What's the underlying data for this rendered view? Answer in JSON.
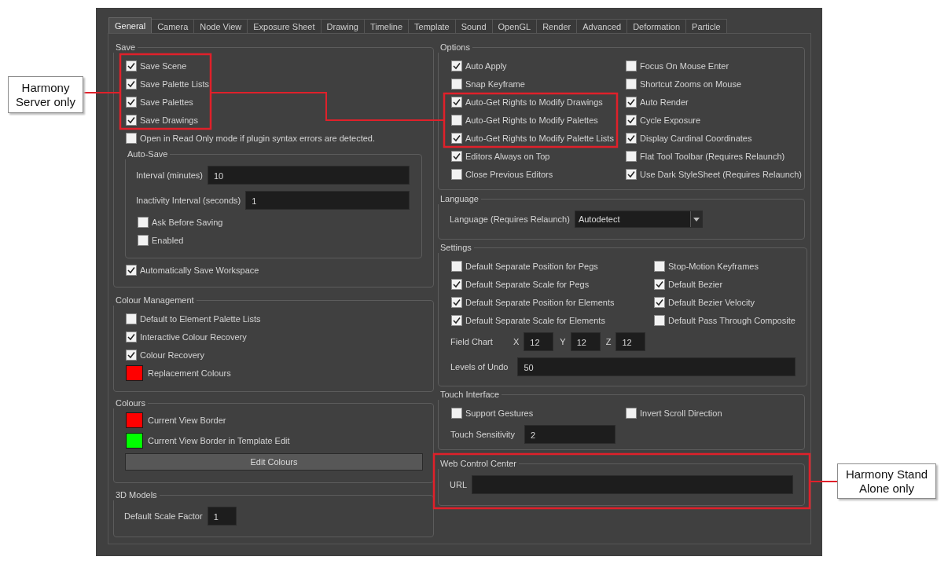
{
  "tabs": [
    {
      "label": "General",
      "selected": true
    },
    {
      "label": "Camera",
      "selected": false
    },
    {
      "label": "Node View",
      "selected": false
    },
    {
      "label": "Exposure Sheet",
      "selected": false
    },
    {
      "label": "Drawing",
      "selected": false
    },
    {
      "label": "Timeline",
      "selected": false
    },
    {
      "label": "Template",
      "selected": false
    },
    {
      "label": "Sound",
      "selected": false
    },
    {
      "label": "OpenGL",
      "selected": false
    },
    {
      "label": "Render",
      "selected": false
    },
    {
      "label": "Advanced",
      "selected": false
    },
    {
      "label": "Deformation",
      "selected": false
    },
    {
      "label": "Particle",
      "selected": false
    }
  ],
  "save": {
    "title": "Save",
    "checks": [
      {
        "label": "Save Scene",
        "checked": true
      },
      {
        "label": "Save Palette Lists",
        "checked": true
      },
      {
        "label": "Save Palettes",
        "checked": true
      },
      {
        "label": "Save Drawings",
        "checked": true
      },
      {
        "label": "Open in Read Only mode if plugin syntax errors are detected.",
        "checked": false
      }
    ],
    "auto_save": {
      "title": "Auto-Save",
      "fields": [
        {
          "label": "Interval (minutes)",
          "value": "10"
        },
        {
          "label": "Inactivity Interval (seconds)",
          "value": "1"
        }
      ],
      "checks": [
        {
          "label": "Ask Before Saving",
          "checked": false
        },
        {
          "label": "Enabled",
          "checked": false
        }
      ]
    },
    "workspace": {
      "label": "Automatically Save Workspace",
      "checked": true
    }
  },
  "colour_management": {
    "title": "Colour Management",
    "checks": [
      {
        "label": "Default to Element Palette Lists",
        "checked": false
      },
      {
        "label": "Interactive Colour Recovery",
        "checked": true
      },
      {
        "label": "Colour Recovery",
        "checked": true
      }
    ],
    "swatch": {
      "label": "Replacement Colours",
      "color": "#ff0000"
    }
  },
  "colours": {
    "title": "Colours",
    "swatches": [
      {
        "label": "Current View Border",
        "color": "#ff0000"
      },
      {
        "label": "Current View Border in Template Edit",
        "color": "#00ff00"
      }
    ],
    "button": "Edit Colours"
  },
  "models_3d": {
    "title": "3D Models",
    "field": {
      "label": "Default Scale Factor",
      "value": "1"
    }
  },
  "options": {
    "title": "Options",
    "left": [
      {
        "label": "Auto Apply",
        "checked": true
      },
      {
        "label": "Snap Keyframe",
        "checked": false
      },
      {
        "label": "Auto-Get Rights to Modify Drawings",
        "checked": true
      },
      {
        "label": "Auto-Get Rights to Modify Palettes",
        "checked": false
      },
      {
        "label": "Auto-Get Rights to Modify Palette Lists",
        "checked": true
      },
      {
        "label": "Editors Always on Top",
        "checked": true
      },
      {
        "label": "Close Previous Editors",
        "checked": false
      }
    ],
    "right": [
      {
        "label": "Focus On Mouse Enter",
        "checked": false
      },
      {
        "label": "Shortcut Zooms on Mouse",
        "checked": false
      },
      {
        "label": "Auto Render",
        "checked": true
      },
      {
        "label": "Cycle Exposure",
        "checked": true
      },
      {
        "label": "Display Cardinal Coordinates",
        "checked": true
      },
      {
        "label": "Flat Tool Toolbar (Requires Relaunch)",
        "checked": false
      },
      {
        "label": "Use Dark StyleSheet (Requires Relaunch)",
        "checked": true
      }
    ]
  },
  "language": {
    "title": "Language",
    "label": "Language (Requires Relaunch)",
    "value": "Autodetect"
  },
  "settings": {
    "title": "Settings",
    "left": [
      {
        "label": "Default Separate Position for Pegs",
        "checked": false
      },
      {
        "label": "Default Separate Scale for Pegs",
        "checked": true
      },
      {
        "label": "Default Separate Position for Elements",
        "checked": true
      },
      {
        "label": "Default Separate Scale for Elements",
        "checked": true
      }
    ],
    "right": [
      {
        "label": "Stop-Motion Keyframes",
        "checked": false
      },
      {
        "label": "Default Bezier",
        "checked": true
      },
      {
        "label": "Default Bezier Velocity",
        "checked": true
      },
      {
        "label": "Default Pass Through Composite",
        "checked": false
      }
    ],
    "field_chart": {
      "label": "Field Chart",
      "axes": [
        {
          "label": "X",
          "value": "12"
        },
        {
          "label": "Y",
          "value": "12"
        },
        {
          "label": "Z",
          "value": "12"
        }
      ]
    },
    "undo": {
      "label": "Levels of Undo",
      "value": "50"
    }
  },
  "touch": {
    "title": "Touch Interface",
    "checks": [
      {
        "label": "Support Gestures",
        "checked": false
      },
      {
        "label": "Invert Scroll Direction",
        "checked": false
      }
    ],
    "sensitivity": {
      "label": "Touch Sensitivity",
      "value": "2"
    }
  },
  "web_control": {
    "title": "Web Control Center",
    "url_label": "URL"
  },
  "callouts": [
    {
      "text": "Harmony Server only"
    },
    {
      "text": "Harmony Stand Alone only"
    }
  ]
}
